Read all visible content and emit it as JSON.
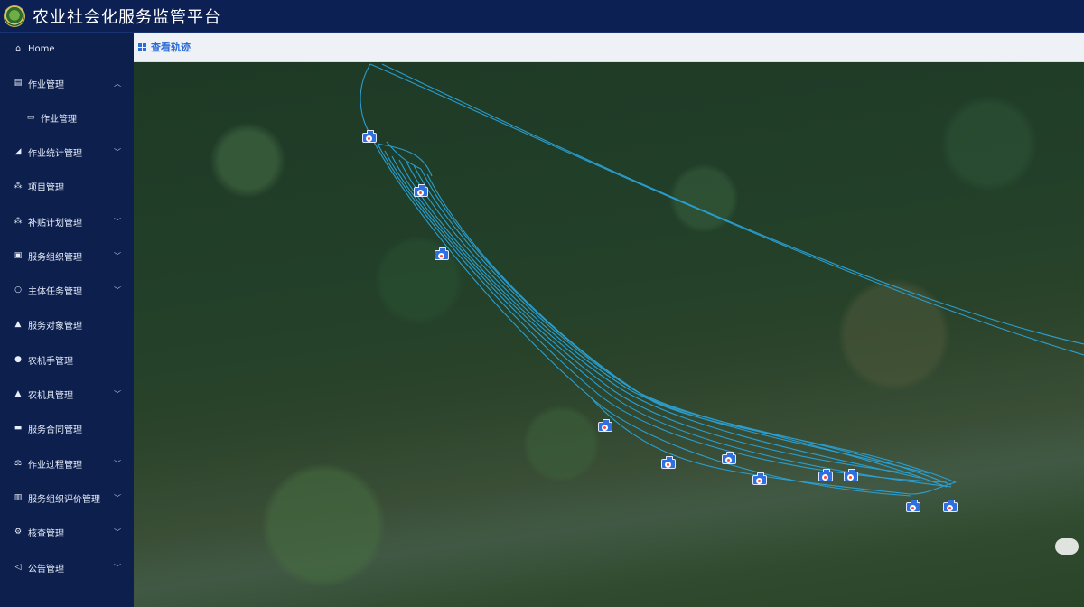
{
  "header": {
    "title": "农业社会化服务监管平台"
  },
  "sidebar": {
    "items": [
      {
        "label": "Home",
        "icon": "home-icon",
        "chevron": ""
      },
      {
        "label": "作业管理",
        "icon": "clipboard-icon",
        "chevron": "^"
      },
      {
        "label": "作业管理",
        "icon": "window-icon",
        "chevron": "",
        "sub": true
      },
      {
        "label": "作业统计管理",
        "icon": "chart-icon",
        "chevron": "v"
      },
      {
        "label": "项目管理",
        "icon": "tree-icon",
        "chevron": ""
      },
      {
        "label": "补贴计划管理",
        "icon": "tree-icon",
        "chevron": "v"
      },
      {
        "label": "服务组织管理",
        "icon": "card-icon",
        "chevron": "v"
      },
      {
        "label": "主体任务管理",
        "icon": "cycle-icon",
        "chevron": "v"
      },
      {
        "label": "服务对象管理",
        "icon": "group-icon",
        "chevron": ""
      },
      {
        "label": "农机手管理",
        "icon": "user-icon",
        "chevron": ""
      },
      {
        "label": "农机具管理",
        "icon": "group-icon",
        "chevron": "v"
      },
      {
        "label": "服务合同管理",
        "icon": "contract-icon",
        "chevron": ""
      },
      {
        "label": "作业过程管理",
        "icon": "scale-icon",
        "chevron": "v"
      },
      {
        "label": "服务组织评价管理",
        "icon": "doc-icon",
        "chevron": "v"
      },
      {
        "label": "核查管理",
        "icon": "gear-icon",
        "chevron": "v"
      },
      {
        "label": "公告管理",
        "icon": "speaker-icon",
        "chevron": "v"
      }
    ]
  },
  "breadcrumb": {
    "label": "查看轨迹",
    "icon": "grid-icon"
  },
  "map": {
    "track_color": "#2aa3d9",
    "marker_color": "#2f6fe0",
    "marker_icon": "camera-icon",
    "marker_count": 12
  }
}
